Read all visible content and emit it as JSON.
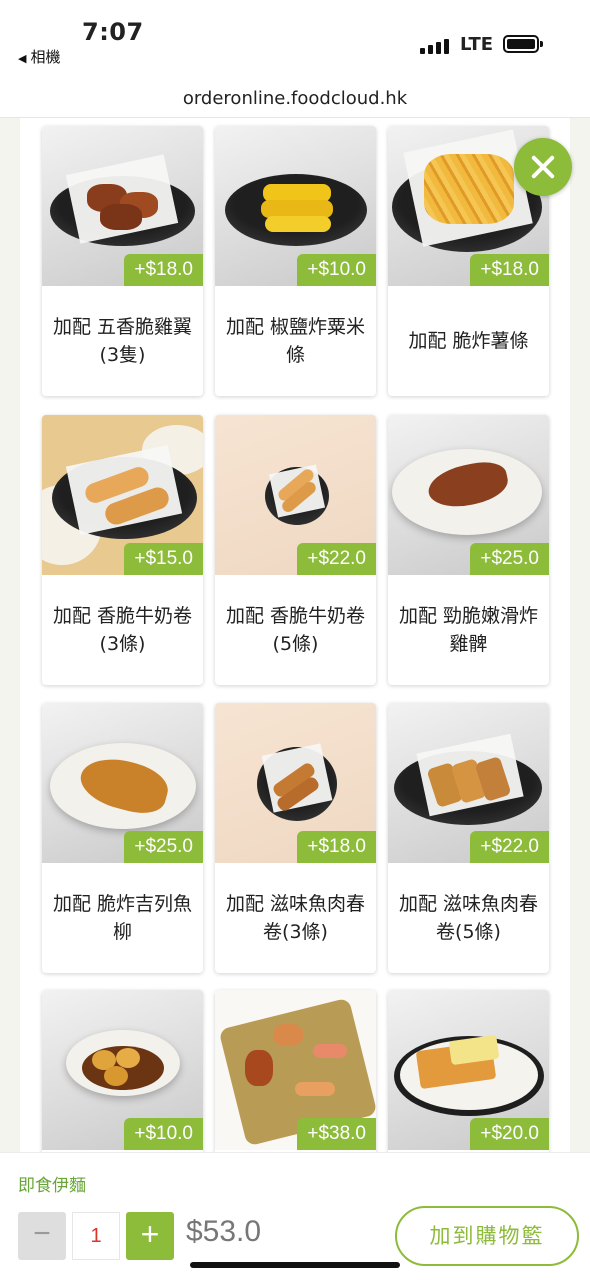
{
  "status_bar": {
    "time": "7:07",
    "back_label": "相機",
    "network": "LTE"
  },
  "browser": {
    "url": "orderonline.foodcloud.hk"
  },
  "addons": [
    {
      "name": "加配 五香脆雞翼(3隻)",
      "price": "+$18.0",
      "image": "wings"
    },
    {
      "name": "加配 椒鹽炸粟米條",
      "price": "+$10.0",
      "image": "corn"
    },
    {
      "name": "加配 脆炸薯條",
      "price": "+$18.0",
      "image": "fries"
    },
    {
      "name": "加配 香脆牛奶卷 (3條)",
      "price": "+$15.0",
      "image": "milk-rolls-3"
    },
    {
      "name": "加配 香脆牛奶卷 (5條)",
      "price": "+$22.0",
      "image": "milk-rolls-5"
    },
    {
      "name": "加配 勁脆嫩滑炸雞髀",
      "price": "+$25.0",
      "image": "drumstick"
    },
    {
      "name": "加配 脆炸吉列魚柳",
      "price": "+$25.0",
      "image": "fish-fillet"
    },
    {
      "name": "加配 滋味魚肉春卷(3條)",
      "price": "+$18.0",
      "image": "spring-rolls-3"
    },
    {
      "name": "加配 滋味魚肉春卷(5條)",
      "price": "+$22.0",
      "image": "spring-rolls-5"
    },
    {
      "name": "",
      "price": "+$10.0",
      "image": "fishballs"
    },
    {
      "name": "",
      "price": "+$38.0",
      "image": "platter"
    },
    {
      "name": "",
      "price": "+$20.0",
      "image": "toast"
    }
  ],
  "selected_item": "即食伊麵",
  "quantity": {
    "minus": "−",
    "value": "1",
    "plus": "+"
  },
  "total_price": "$53.0",
  "add_to_cart_label": "加到購物籃",
  "colors": {
    "accent": "#8dbb3a",
    "qty_text": "#d9362b"
  },
  "icons": {
    "close": "close-icon"
  }
}
